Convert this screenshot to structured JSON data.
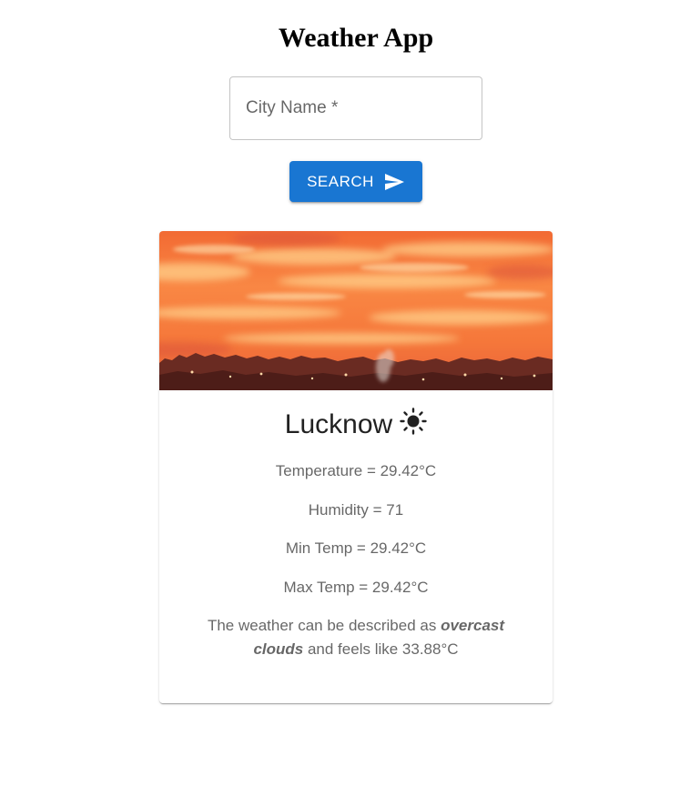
{
  "app": {
    "title": "Weather App"
  },
  "search": {
    "placeholder": "City Name *",
    "value": "",
    "button_label": "Search",
    "button_icon": "send-icon",
    "accent_color": "#1976d2"
  },
  "card": {
    "image": "sunset-sky-image",
    "city": "Lucknow",
    "weather_icon": "sun-icon",
    "temperature": "Temperature = 29.42°C",
    "humidity": "Humidity = 71",
    "min_temp": "Min Temp = 29.42°C",
    "max_temp": "Max Temp = 29.42°C",
    "description": {
      "prefix": "The weather can be described as ",
      "condition": "overcast clouds",
      "suffix": "  and feels like 33.88°C"
    }
  }
}
